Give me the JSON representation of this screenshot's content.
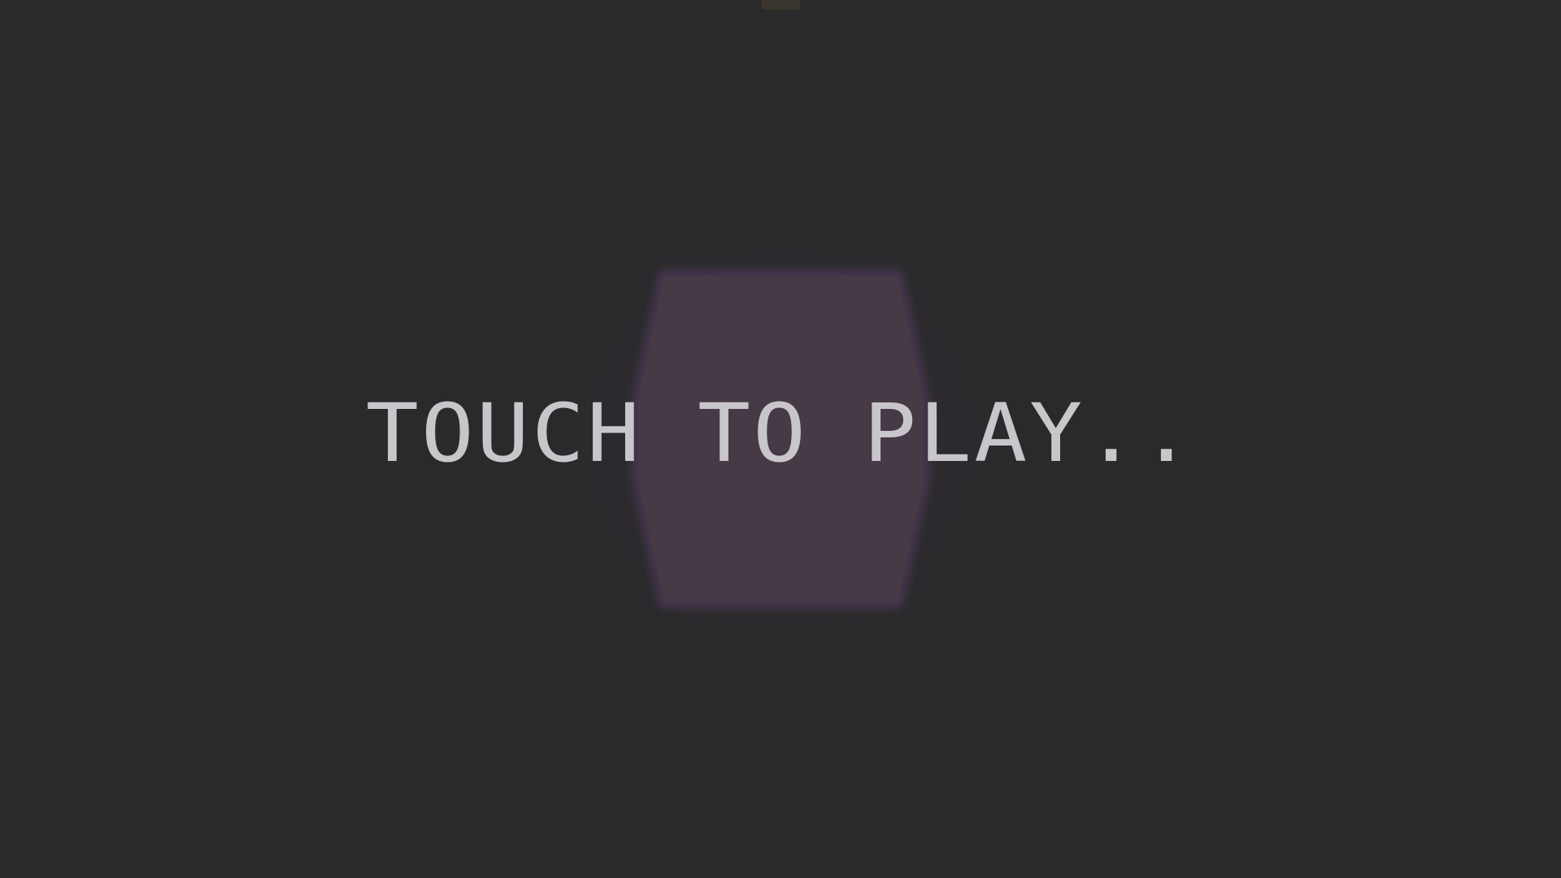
{
  "screen": {
    "name": "title-screen",
    "prompt": "TOUCH TO PLAY.."
  },
  "colors": {
    "background": "#2a2a2a",
    "hexagon_fill": "#453a45",
    "hexagon_edge": "#5a3f6a",
    "text": "#c9c6cb",
    "top_marker": "#3a352c"
  },
  "icons": {
    "center_shape": "hexagon-icon"
  }
}
